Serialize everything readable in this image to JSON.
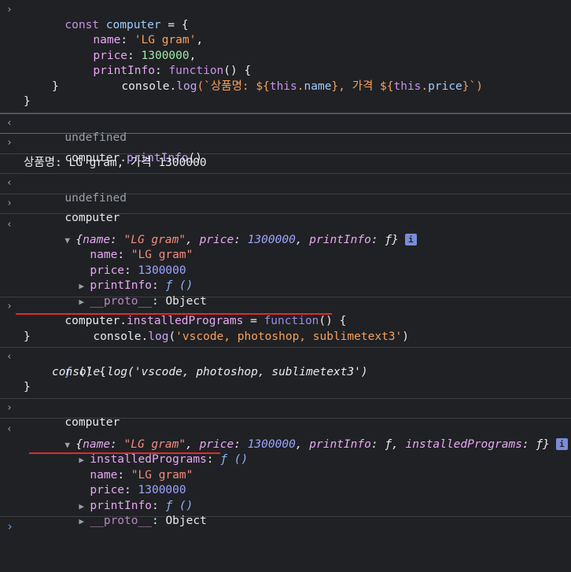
{
  "console": {
    "code1": {
      "line1": [
        "const",
        " ",
        "computer",
        " = {"
      ],
      "line2": [
        "name",
        ": ",
        "'LG gram'",
        ","
      ],
      "line3": [
        "price",
        ": ",
        "1300000",
        ","
      ],
      "line4": [
        "printInfo",
        ": ",
        "function",
        "() {"
      ],
      "line5": [
        "console",
        ".",
        "log",
        "(`상품명: ${",
        "this",
        ".",
        "name",
        "}, 가격 ${",
        "this",
        ".",
        "price",
        "}`)"
      ],
      "line6": "}",
      "line7": "}"
    },
    "result1": "undefined",
    "input2": [
      "computer",
      ".",
      "printInfo",
      "()"
    ],
    "output2": "상품명: LG gram, 가격 1300000",
    "result2": "undefined",
    "input3": "computer",
    "obj1": {
      "summary": [
        "{",
        "name",
        ": ",
        "\"LG gram\"",
        ", ",
        "price",
        ": ",
        "1300000",
        ", ",
        "printInfo",
        ": ",
        "ƒ",
        "}"
      ],
      "info": "i",
      "props": [
        {
          "key": "name",
          "sep": ": ",
          "value": "\"LG gram\""
        },
        {
          "key": "price",
          "sep": ": ",
          "value": "1300000"
        },
        {
          "key": "printInfo",
          "sep": ": ",
          "value": "ƒ ()"
        },
        {
          "key": "__proto__",
          "sep": ": ",
          "value": "Object"
        }
      ]
    },
    "input4": {
      "line1": [
        "computer",
        ".",
        "installedPrograms",
        " = ",
        "function",
        "() {"
      ],
      "line2": [
        "console",
        ".",
        "log",
        "(",
        "'vscode, photoshop, sublimetext3'",
        ")"
      ],
      "line3": "}"
    },
    "result4": {
      "line1": [
        "ƒ",
        " () {"
      ],
      "line2": "console.log('vscode, photoshop, sublimetext3')",
      "line3": "}"
    },
    "input5": "computer",
    "obj2": {
      "summary": [
        "{",
        "name",
        ": ",
        "\"LG gram\"",
        ", ",
        "price",
        ": ",
        "1300000",
        ", ",
        "printInfo",
        ": ",
        "ƒ",
        ", ",
        "installedPrograms",
        ": ",
        "ƒ",
        "}"
      ],
      "info": "i",
      "props": [
        {
          "key": "installedPrograms",
          "sep": ": ",
          "value": "ƒ ()"
        },
        {
          "key": "name",
          "sep": ": ",
          "value": "\"LG gram\""
        },
        {
          "key": "price",
          "sep": ": ",
          "value": "1300000"
        },
        {
          "key": "printInfo",
          "sep": ": ",
          "value": "ƒ ()"
        },
        {
          "key": "__proto__",
          "sep": ": ",
          "value": "Object"
        }
      ]
    },
    "prompt_symbol": "›",
    "input_symbol": "›",
    "output_symbol": "‹",
    "expand_symbol": "▼",
    "collapsed_symbol": "▶"
  },
  "colors": {
    "background": "#202124",
    "annotation_underline": "#e02b2b",
    "prompt": "#4ea1ff"
  }
}
